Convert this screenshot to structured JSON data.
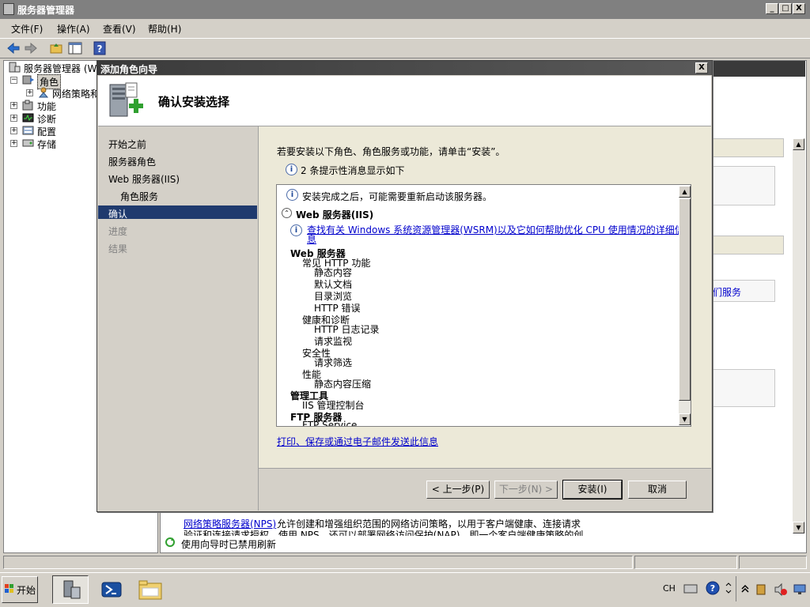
{
  "window": {
    "title": "服务器管理器",
    "minimize": "_",
    "maximize": "□",
    "close": "X"
  },
  "menubar": {
    "items": [
      "文件(F)",
      "操作(A)",
      "查看(V)",
      "帮助(H)"
    ]
  },
  "tree": {
    "root": "服务器管理器 (WI",
    "items": [
      {
        "label": "角色",
        "expander": "−"
      },
      {
        "label": "网络策略和",
        "expander": "+"
      },
      {
        "label": "功能",
        "expander": "+"
      },
      {
        "label": "诊断",
        "expander": "+"
      },
      {
        "label": "配置",
        "expander": "+"
      },
      {
        "label": "存储",
        "expander": "+"
      }
    ]
  },
  "background_pane": {
    "link_fragment": "们服务",
    "bottom_text_link": "网络策略服务器(NPS)",
    "bottom_text_rest": "允许创建和增强组织范围的网络访问策略，以用于客户端健康、连接请求",
    "bottom_text_line2": "验证和连接请求授权。使用 NPS，还可以部署网络访问保护(NAP)，即一个客户端健康策略的创",
    "refresh_status": "使用向导时已禁用刷新"
  },
  "dialog": {
    "title": "添加角色向导",
    "close": "X",
    "header_title": "确认安装选择",
    "steps": [
      {
        "label": "开始之前",
        "state": "done"
      },
      {
        "label": "服务器角色",
        "state": "done"
      },
      {
        "label": "Web 服务器(IIS)",
        "state": "done"
      },
      {
        "label": "角色服务",
        "state": "done",
        "indent": true
      },
      {
        "label": "确认",
        "state": "active"
      },
      {
        "label": "进度",
        "state": "pending"
      },
      {
        "label": "结果",
        "state": "pending"
      }
    ],
    "intro": "若要安装以下角色、角色服务或功能，请单击“安装”。",
    "info_count": "2 条提示性消息显示如下",
    "list": {
      "restart_note": "安装完成之后，可能需要重新启动该服务器。",
      "section_title": "Web 服务器(IIS)",
      "wsrm_link_line1": "查找有关 Windows 系统资源管理器(WSRM)以及它如何帮助优化 CPU 使用情况的详细信",
      "wsrm_link_line2": "息",
      "items": [
        {
          "text": "Web 服务器",
          "level": 0,
          "bold": true
        },
        {
          "text": "常见 HTTP 功能",
          "level": 1
        },
        {
          "text": "静态内容",
          "level": 2
        },
        {
          "text": "默认文档",
          "level": 2
        },
        {
          "text": "目录浏览",
          "level": 2
        },
        {
          "text": "HTTP 错误",
          "level": 2
        },
        {
          "text": "健康和诊断",
          "level": 1
        },
        {
          "text": "HTTP 日志记录",
          "level": 2
        },
        {
          "text": "请求监视",
          "level": 2
        },
        {
          "text": "安全性",
          "level": 1
        },
        {
          "text": "请求筛选",
          "level": 2
        },
        {
          "text": "性能",
          "level": 1
        },
        {
          "text": "静态内容压缩",
          "level": 2
        },
        {
          "text": "管理工具",
          "level": 0,
          "bold": true
        },
        {
          "text": "IIS 管理控制台",
          "level": 1
        },
        {
          "text": "FTP 服务器",
          "level": 0,
          "bold": true
        },
        {
          "text": "FTP Service",
          "level": 1
        }
      ]
    },
    "print_link": "打印、保存或通过电子邮件发送此信息",
    "buttons": {
      "prev": "< 上一步(P)",
      "next": "下一步(N) >",
      "install": "安装(I)",
      "cancel": "取消"
    }
  },
  "taskbar": {
    "start": "开始",
    "lang": "CH"
  }
}
